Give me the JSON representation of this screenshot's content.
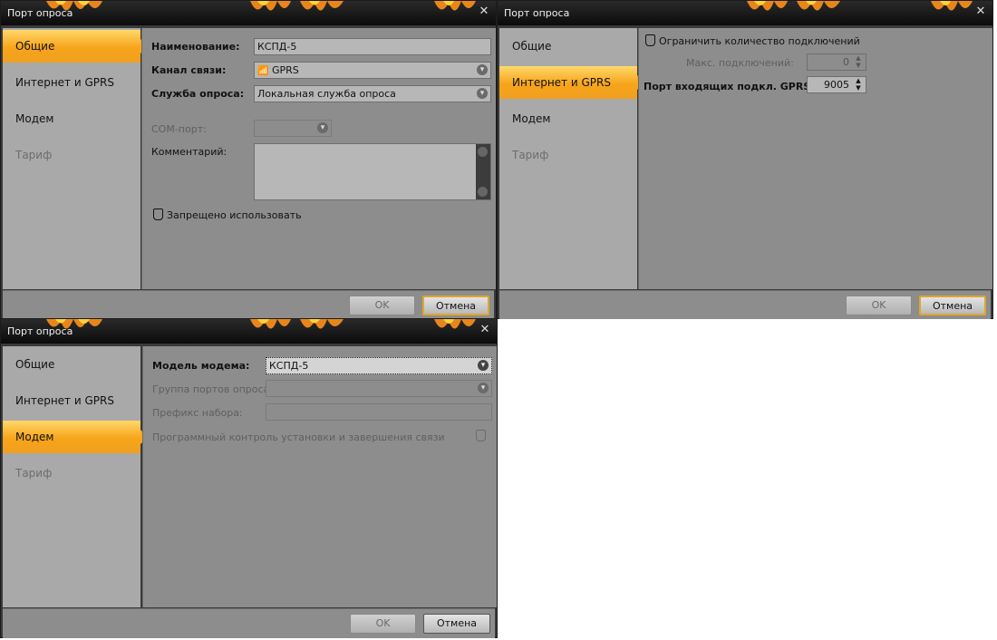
{
  "window_title": "Порт опроса",
  "sidebar": {
    "items": [
      {
        "label": "Общие"
      },
      {
        "label": "Интернет и GPRS"
      },
      {
        "label": "Модем"
      },
      {
        "label": "Тариф"
      }
    ]
  },
  "buttons": {
    "ok": "OK",
    "cancel": "Отмена"
  },
  "general": {
    "name_label": "Наименование:",
    "name_value": "КСПД-5",
    "channel_label": "Канал связи:",
    "channel_value": "GPRS",
    "service_label": "Служба опроса:",
    "service_value": "Локальная служба опроса",
    "com_label": "COM-порт:",
    "com_value": "",
    "comment_label": "Комментарий:",
    "comment_value": "",
    "forbid_label": "Запрещено использовать",
    "forbid_checked": false
  },
  "internet": {
    "limit_label": "Ограничить количество подключений",
    "limit_checked": false,
    "max_label": "Макс. подключений:",
    "max_value": "0",
    "port_label": "Порт входящих подкл. GPRS:",
    "port_value": "9005"
  },
  "modem": {
    "model_label": "Модель модема:",
    "model_value": "КСПД-5",
    "group_label": "Группа портов опроса:",
    "group_value": "",
    "prefix_label": "Префикс набора:",
    "prefix_value": "",
    "control_label": "Программный контроль установки и завершения связи"
  }
}
